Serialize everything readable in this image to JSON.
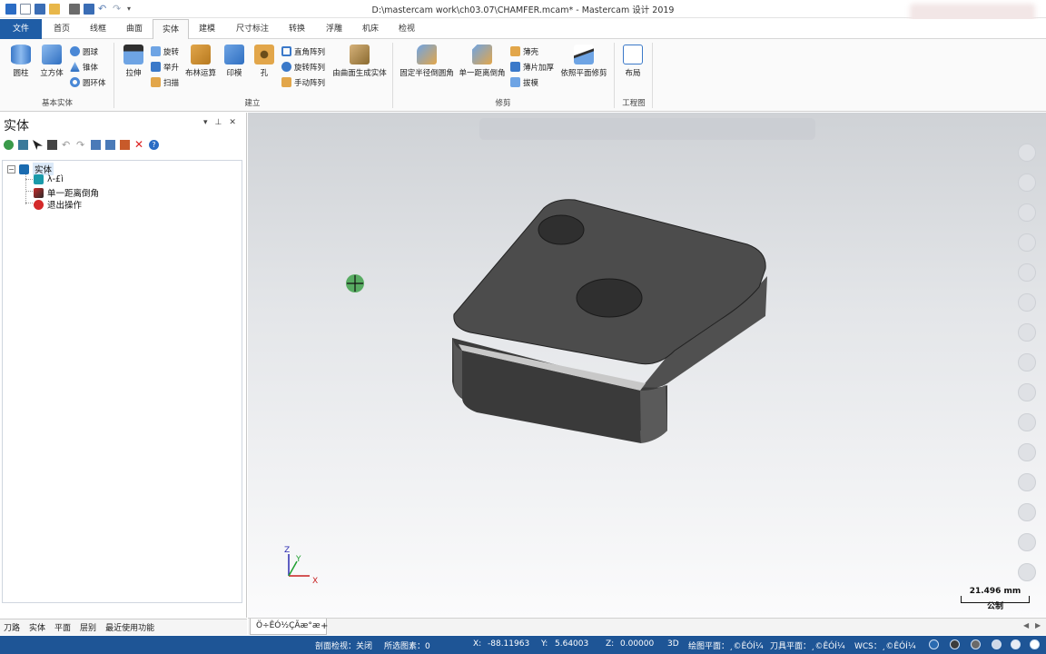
{
  "window": {
    "title": "D:\\mastercam work\\ch03.07\\CHAMFER.mcam* - Mastercam 设计 2019"
  },
  "menu_tabs": [
    "文件",
    "首页",
    "线框",
    "曲面",
    "实体",
    "建模",
    "尺寸标注",
    "转换",
    "浮雕",
    "机床",
    "检视"
  ],
  "active_tab": "实体",
  "ribbon": {
    "basic_solids": {
      "label": "基本实体",
      "cylinder": "圆柱",
      "block": "立方体",
      "sphere": "圆球",
      "cone": "锥体",
      "torus": "圆环体"
    },
    "create": {
      "label": "建立",
      "extrude": "拉伸",
      "revolve": "旋转",
      "loft": "举升",
      "sweep": "扫描",
      "boolean": "布林运算",
      "impression": "印模",
      "hole": "孔",
      "rect_pattern": "直角阵列",
      "rotary_pattern": "旋转阵列",
      "manual_pattern": "手动阵列",
      "from_surfaces": "由曲面生成实体"
    },
    "modify": {
      "label": "修剪",
      "fillet": "固定半径倒圆角",
      "chamfer": "单一距离倒角",
      "shell": "薄壳",
      "thicken": "薄片加厚",
      "draft": "拔模",
      "trim_to_plane": "依照平面修剪"
    },
    "drawing": {
      "label": "工程图",
      "layout": "布局"
    }
  },
  "panel": {
    "title": "实体",
    "tree": {
      "root": "实体",
      "item1": "λ-£ì",
      "item2": "单一距离倒角",
      "item3": "退出操作"
    },
    "bottom_tabs": [
      "刀路",
      "实体",
      "平面",
      "层别",
      "最近使用功能"
    ]
  },
  "viewport": {
    "tab": "Ö÷ÊÓ½ÇÃæ°æ",
    "add_tab": "+",
    "scale_value": "21.496 mm",
    "scale_unit": "公制",
    "axes": {
      "x": "X",
      "y": "Y",
      "z": "Z"
    }
  },
  "status": {
    "section_view": "剖面检视：关闭",
    "selected": "所选图素：0",
    "x_label": "X:",
    "x": "-88.11963",
    "y_label": "Y:",
    "y": "5.64003",
    "z_label": "Z:",
    "z": "0.00000",
    "mode": "3D",
    "cplane": "绘图平面：¸©ÊÓÍ¼",
    "tplane": "刀具平面：¸©ÊÓÍ¼",
    "wcs": "WCS：¸©ÊÓÍ¼"
  },
  "colors": {
    "accent": "#1f5da6",
    "status_bg": "#1e5596",
    "solid_face": "#4c4c4c"
  }
}
